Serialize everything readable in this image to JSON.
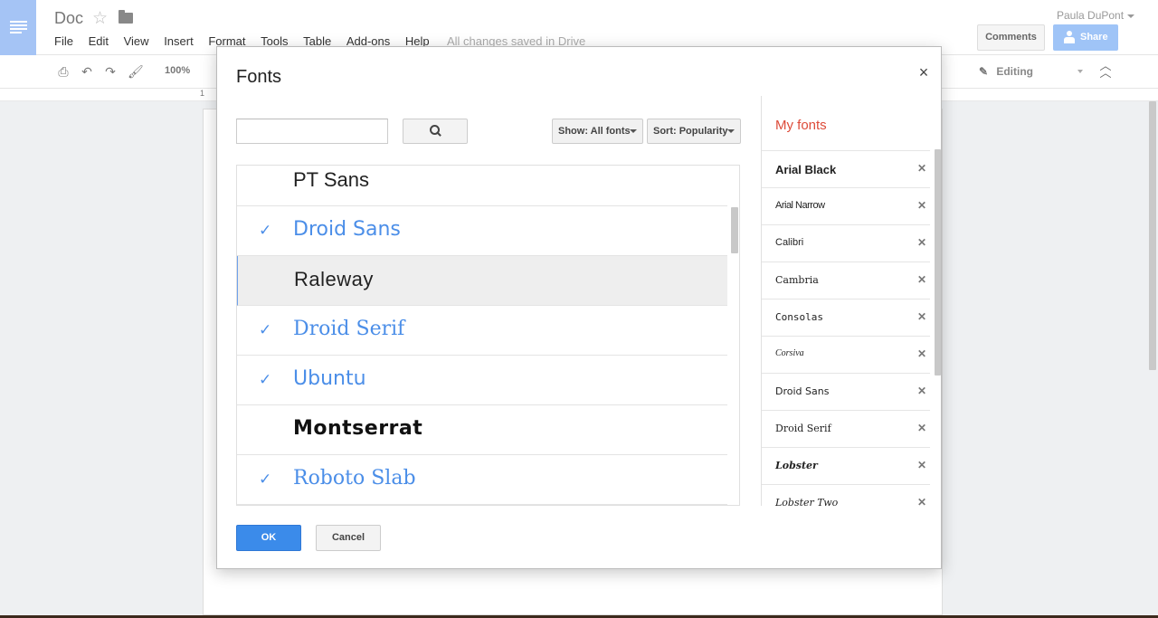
{
  "app": {
    "doc_title": "Doc",
    "menu": [
      "File",
      "Edit",
      "View",
      "Insert",
      "Format",
      "Tools",
      "Table",
      "Add-ons",
      "Help"
    ],
    "save_status": "All changes saved in Drive",
    "user_name": "Paula DuPont",
    "comments_label": "Comments",
    "share_label": "Share"
  },
  "toolbar": {
    "zoom": "100%",
    "mode": "Editing",
    "icons": [
      "print-icon",
      "undo-icon",
      "redo-icon",
      "paint-format-icon"
    ]
  },
  "ruler": {
    "mark": "1"
  },
  "dialog": {
    "title": "Fonts",
    "search": {
      "value": "",
      "placeholder": ""
    },
    "show_filter": "Show: All fonts",
    "sort": "Sort: Popularity",
    "fonts": [
      {
        "name": "PT Sans",
        "selected": false
      },
      {
        "name": "Droid Sans",
        "selected": true
      },
      {
        "name": "Raleway",
        "selected": false
      },
      {
        "name": "Droid Serif",
        "selected": true
      },
      {
        "name": "Ubuntu",
        "selected": true
      },
      {
        "name": "Montserrat",
        "selected": false
      },
      {
        "name": "Roboto Slab",
        "selected": true
      }
    ],
    "my_fonts_title": "My fonts",
    "my_fonts": [
      "Arial Black",
      "Arial Narrow",
      "Calibri",
      "Cambria",
      "Consolas",
      "Corsiva",
      "Droid Sans",
      "Droid Serif",
      "Lobster",
      "Lobster Two"
    ],
    "ok_label": "OK",
    "cancel_label": "Cancel"
  },
  "colors": {
    "accent_blue": "#4b8ee8",
    "ok_button": "#3b8bea",
    "my_fonts_title": "#dd4b39",
    "docs_logo": "#a5c4f5"
  }
}
